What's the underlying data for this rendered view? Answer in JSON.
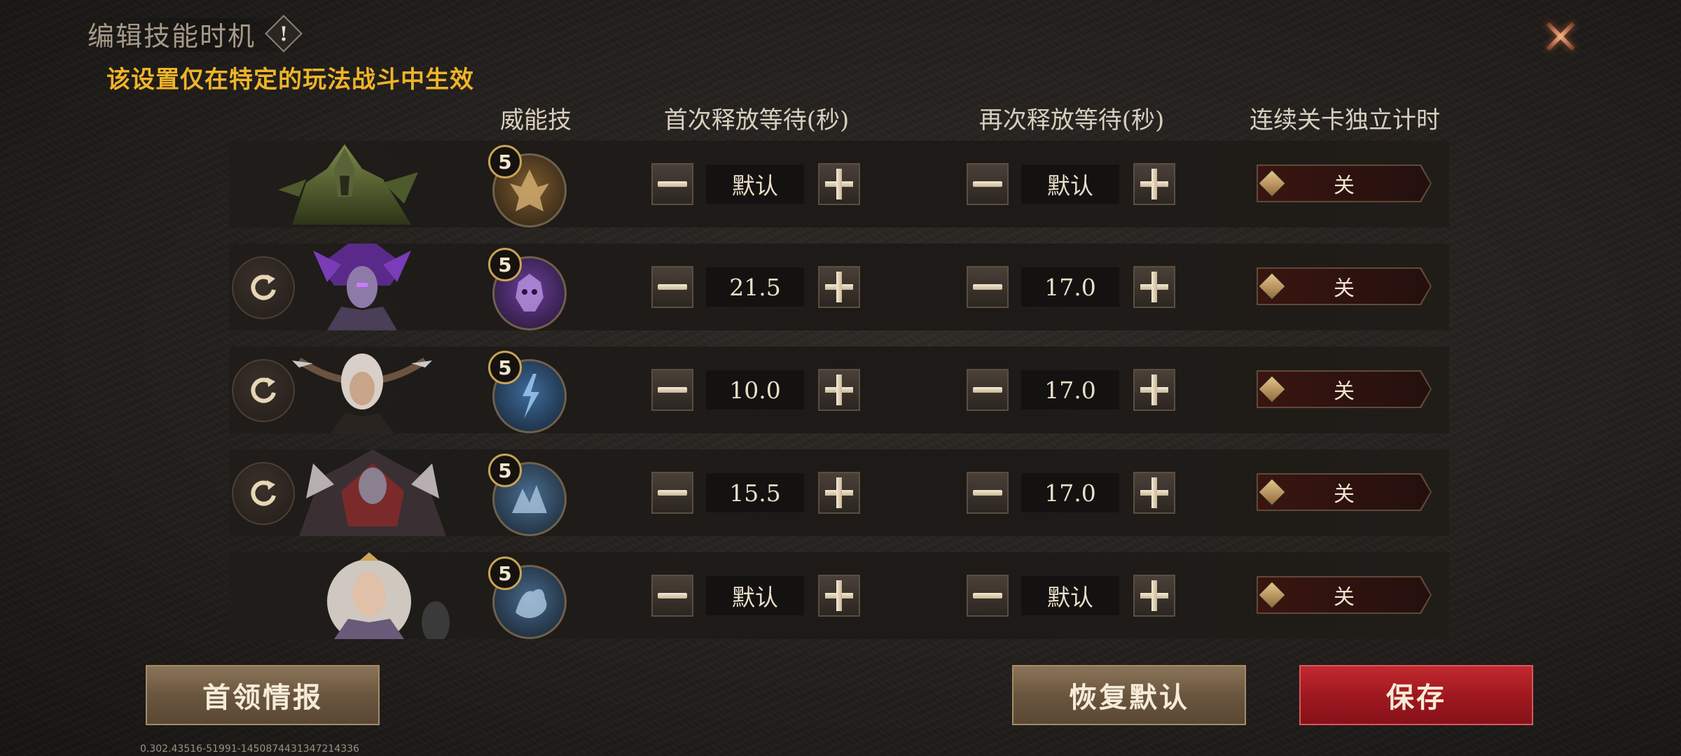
{
  "header": {
    "title": "编辑技能时机",
    "help_glyph": "!",
    "subtitle": "该设置仅在特定的玩法战斗中生效",
    "close_icon": "close-x-icon"
  },
  "columns": {
    "skill": "威能技",
    "first_wait": "首次释放等待(秒)",
    "repeat_wait": "再次释放等待(秒)",
    "independent_timer": "连续关卡独立计时"
  },
  "rows": [
    {
      "has_reset": false,
      "skill_level": "5",
      "first_wait": "默认",
      "repeat_wait": "默认",
      "toggle": "关",
      "skill_color": "#b08a4a"
    },
    {
      "has_reset": true,
      "skill_level": "5",
      "first_wait": "21.5",
      "repeat_wait": "17.0",
      "toggle": "关",
      "skill_color": "#8a55b8"
    },
    {
      "has_reset": true,
      "skill_level": "5",
      "first_wait": "10.0",
      "repeat_wait": "17.0",
      "toggle": "关",
      "skill_color": "#4e7fb4"
    },
    {
      "has_reset": true,
      "skill_level": "5",
      "first_wait": "15.5",
      "repeat_wait": "17.0",
      "toggle": "关",
      "skill_color": "#5e86ad"
    },
    {
      "has_reset": false,
      "skill_level": "5",
      "first_wait": "默认",
      "repeat_wait": "默认",
      "toggle": "关",
      "skill_color": "#5a7fa6"
    }
  ],
  "footer": {
    "boss_info": "首领情报",
    "restore_default": "恢复默认",
    "save": "保存",
    "version": "0.302.43516-51991-1450874431347214336"
  }
}
